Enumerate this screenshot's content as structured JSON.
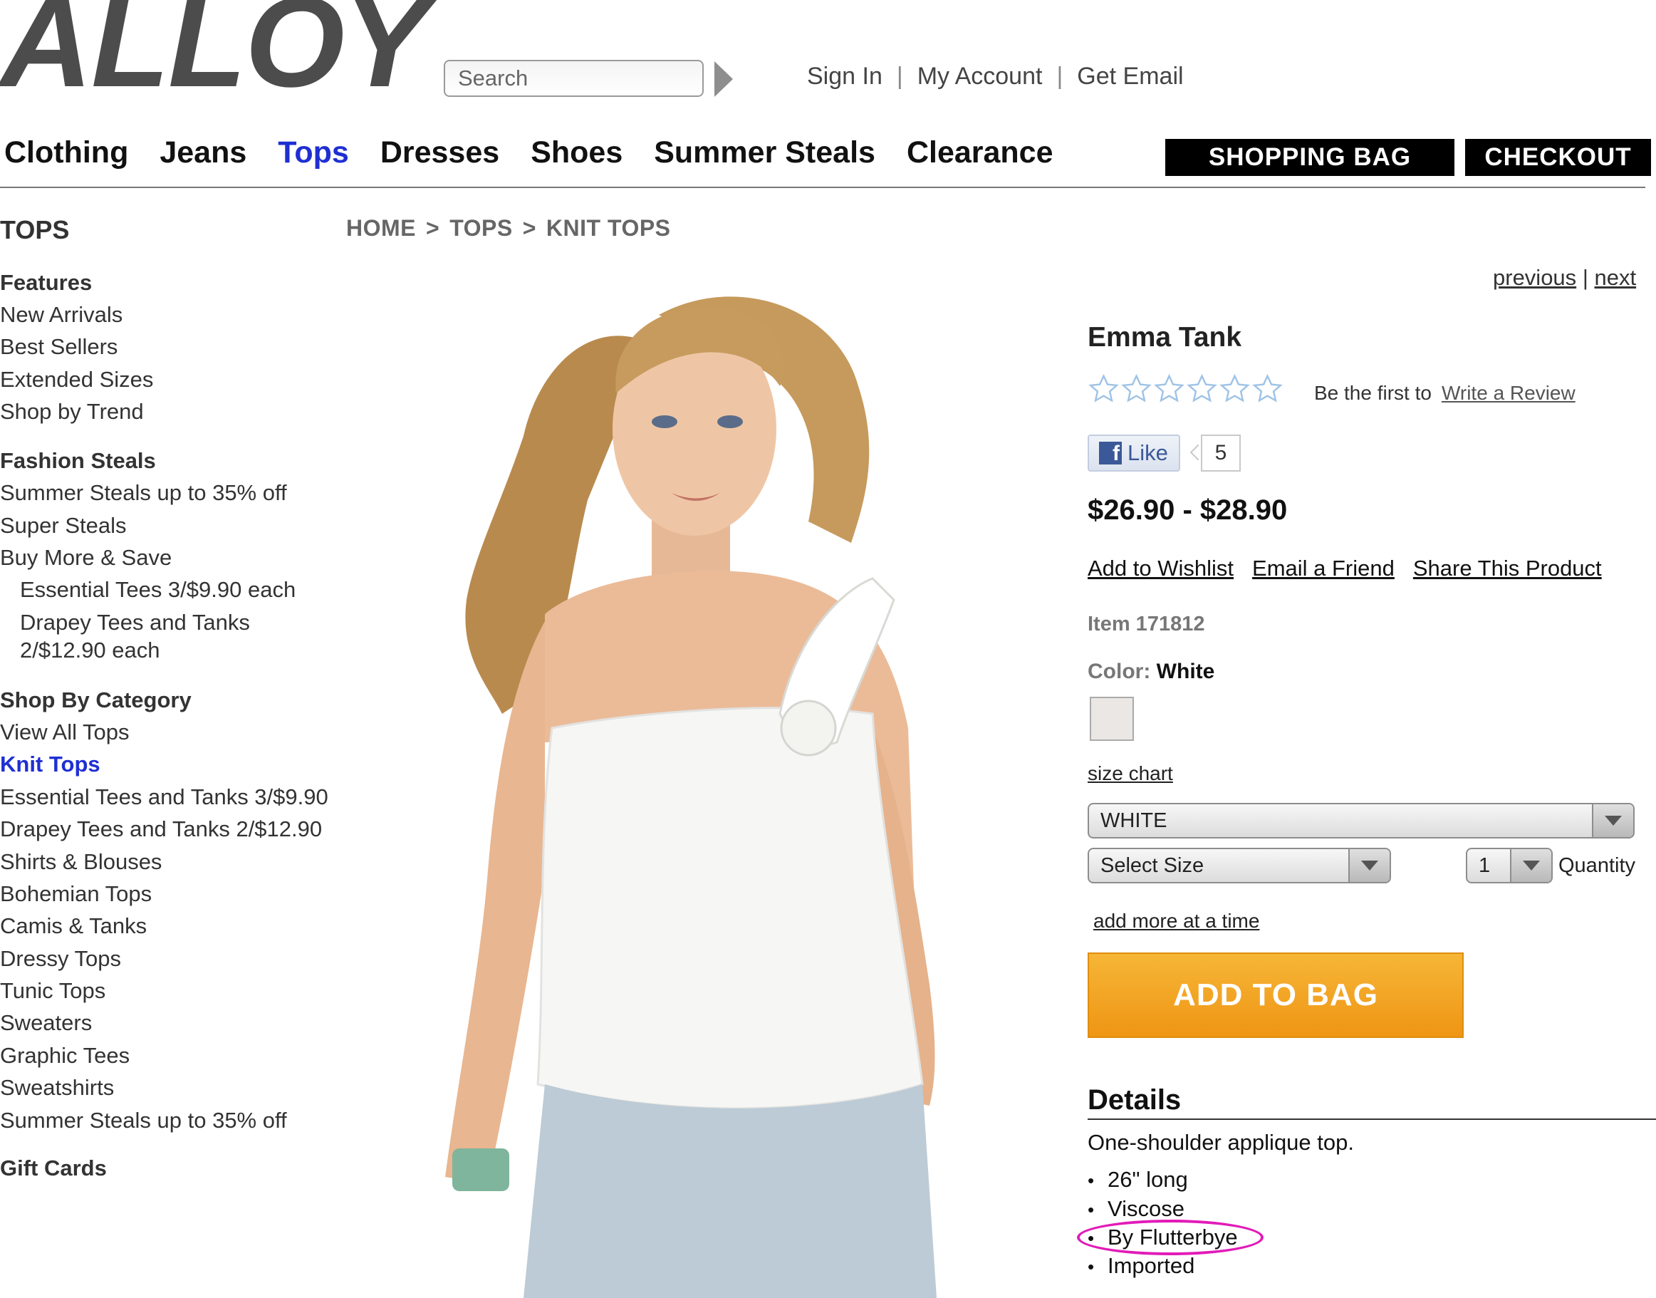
{
  "header": {
    "logo": "ALLOY",
    "search": {
      "placeholder": "Search"
    },
    "links": [
      "Sign In",
      "My Account",
      "Get Email"
    ],
    "nav": [
      "Clothing",
      "Jeans",
      "Tops",
      "Dresses",
      "Shoes",
      "Summer Steals",
      "Clearance"
    ],
    "nav_active": "Tops",
    "shopping_bag": "SHOPPING BAG",
    "checkout": "CHECKOUT"
  },
  "sidebar": {
    "title": "TOPS",
    "features_heading": "Features",
    "features": [
      "New Arrivals",
      "Best Sellers",
      "Extended Sizes",
      "Shop by Trend"
    ],
    "fashion_heading": "Fashion Steals",
    "fashion": [
      "Summer Steals up to 35% off",
      "Super Steals",
      "Buy More & Save"
    ],
    "fashion_sub": [
      "Essential Tees 3/$9.90 each",
      "Drapey Tees and Tanks",
      "2/$12.90 each"
    ],
    "category_heading": "Shop By Category",
    "categories": [
      "View All Tops",
      "Knit Tops",
      "Essential Tees and Tanks 3/$9.90",
      "Drapey Tees and Tanks 2/$12.90",
      "Shirts & Blouses",
      "Bohemian Tops",
      "Camis & Tanks",
      "Dressy Tops",
      "Tunic Tops",
      "Sweaters",
      "Graphic Tees",
      "Sweatshirts",
      "Summer Steals up to 35% off"
    ],
    "category_active": "Knit Tops",
    "gift_cards": "Gift Cards"
  },
  "breadcrumb": [
    "HOME",
    "TOPS",
    "KNIT TOPS"
  ],
  "breadcrumb_sep": ">",
  "pager": {
    "previous": "previous",
    "sep": "|",
    "next": "next"
  },
  "product": {
    "name": "Emma Tank",
    "rating": 0,
    "rating_max": 6,
    "review_prompt": "Be the first to",
    "review_link": "Write a Review",
    "like_label": "Like",
    "like_count": "5",
    "price": "$26.90 - $28.90",
    "actions": [
      "Add to Wishlist",
      "Email a Friend",
      "Share This Product"
    ],
    "item": "Item 171812",
    "color_label": "Color:",
    "color_value": "White",
    "swatch_color": "#ebe7e4",
    "size_chart": "size chart",
    "color_select": "WHITE",
    "size_select": "Select Size",
    "qty_value": "1",
    "qty_label": "Quantity",
    "add_more": "add more at a time",
    "add_to_bag": "ADD TO BAG",
    "add_to_bag_color": "#f2a424",
    "details_heading": "Details",
    "details_desc": "One-shoulder applique top.",
    "details_bullets": [
      "26\" long",
      "Viscose",
      "By Flutterbye",
      "Imported"
    ],
    "highlight_color": "#e21bb8"
  },
  "colors": {
    "link_active": "#1f2fd3",
    "logo": "#4c4c4c"
  }
}
